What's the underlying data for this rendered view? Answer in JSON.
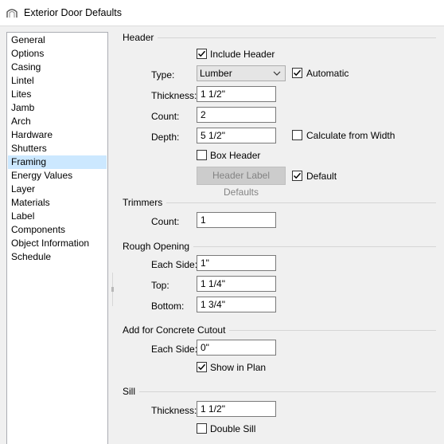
{
  "window": {
    "title": "Exterior Door Defaults",
    "icon": "door-icon"
  },
  "sidebar": {
    "selected": "Framing",
    "items": [
      {
        "label": "General"
      },
      {
        "label": "Options"
      },
      {
        "label": "Casing"
      },
      {
        "label": "Lintel"
      },
      {
        "label": "Lites"
      },
      {
        "label": "Jamb"
      },
      {
        "label": "Arch"
      },
      {
        "label": "Hardware"
      },
      {
        "label": "Shutters"
      },
      {
        "label": "Framing"
      },
      {
        "label": "Energy Values"
      },
      {
        "label": "Layer"
      },
      {
        "label": "Materials"
      },
      {
        "label": "Label"
      },
      {
        "label": "Components"
      },
      {
        "label": "Object Information"
      },
      {
        "label": "Schedule"
      }
    ]
  },
  "header": {
    "section_label": "Header",
    "include_header_label": "Include Header",
    "include_header_checked": true,
    "type_label": "Type:",
    "type_value": "Lumber",
    "automatic_label": "Automatic",
    "automatic_checked": true,
    "thickness_label": "Thickness:",
    "thickness_value": "1 1/2\"",
    "count_label": "Count:",
    "count_value": "2",
    "depth_label": "Depth:",
    "depth_value": "5 1/2\"",
    "calc_from_width_label": "Calculate from Width",
    "calc_from_width_checked": false,
    "box_header_label": "Box Header",
    "box_header_checked": false,
    "label_defaults_button": "Header Label Defaults",
    "default_label": "Default",
    "default_checked": true
  },
  "trimmers": {
    "section_label": "Trimmers",
    "count_label": "Count:",
    "count_value": "1"
  },
  "rough_opening": {
    "section_label": "Rough Opening",
    "each_side_label": "Each Side:",
    "each_side_value": "1\"",
    "top_label": "Top:",
    "top_value": "1 1/4\"",
    "bottom_label": "Bottom:",
    "bottom_value": "1 3/4\""
  },
  "concrete_cutout": {
    "section_label": "Add for Concrete Cutout",
    "each_side_label": "Each Side:",
    "each_side_value": "0\"",
    "show_in_plan_label": "Show in Plan",
    "show_in_plan_checked": true
  },
  "sill": {
    "section_label": "Sill",
    "thickness_label": "Thickness:",
    "thickness_value": "1 1/2\"",
    "double_sill_label": "Double Sill",
    "double_sill_checked": false
  },
  "colors": {
    "selection": "#cce8ff",
    "background": "#f0f0f0"
  }
}
